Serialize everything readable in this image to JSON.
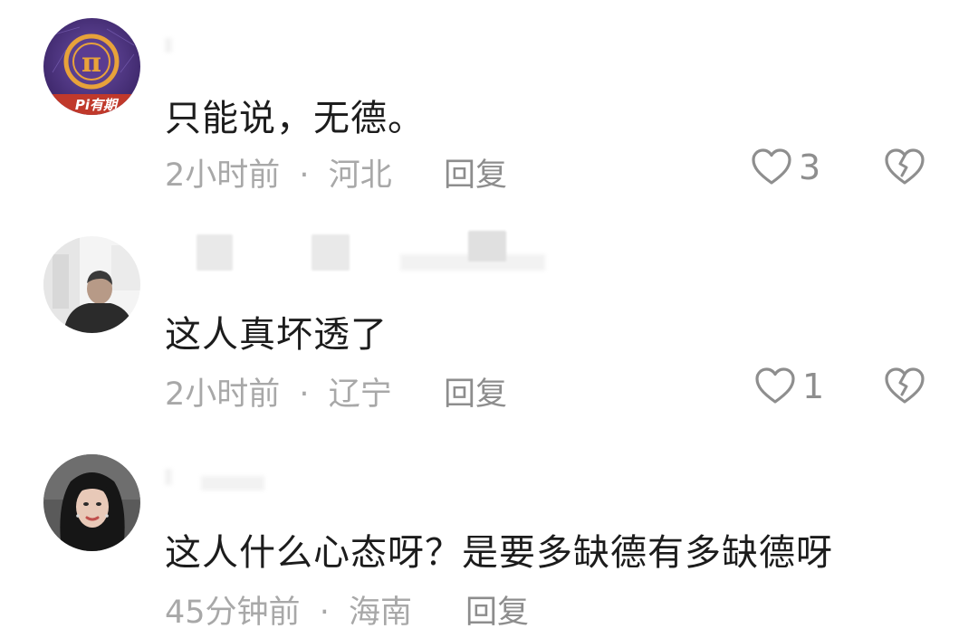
{
  "comments": [
    {
      "avatar_text": "Pi有期",
      "avatar_symbol": "π",
      "text": "只能说，无德。",
      "time": "2小时前",
      "separator": "·",
      "location": "河北",
      "reply_label": "回复",
      "likes": "3"
    },
    {
      "text": "这人真坏透了",
      "time": "2小时前",
      "separator": "·",
      "location": "辽宁",
      "reply_label": "回复",
      "likes": "1"
    },
    {
      "text": "这人什么心态呀？是要多缺德有多缺德呀",
      "time": "45分钟前",
      "separator": "·",
      "location": "海南",
      "reply_label": "回复"
    }
  ],
  "colors": {
    "accent_avatar_1": "#4a2f7a",
    "avatar_banner": "#c0392b",
    "pi_gold": "#e8a23a",
    "text_main": "#1c1c1c",
    "text_meta": "#a8a8a8",
    "icon_gray": "#8e8e8e"
  },
  "icons": {
    "like": "heart-outline-icon",
    "dislike": "broken-heart-icon"
  }
}
